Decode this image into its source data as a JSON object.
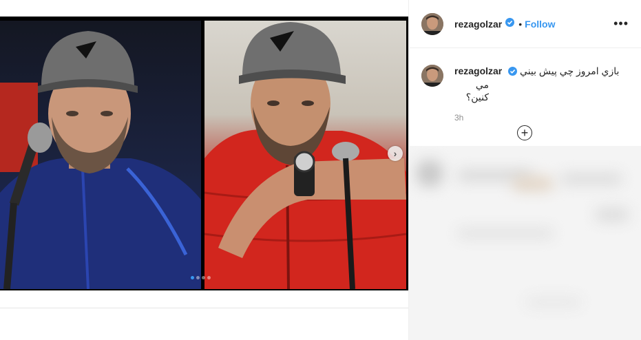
{
  "post": {
    "username": "rezagolzar",
    "follow_label": "Follow",
    "separator": "•",
    "more_label": "•••",
    "caption_line1": "بازي امروز چي پيش بيني",
    "caption_line2": "مي كنين؟",
    "time": "3h",
    "add_comment_icon": "+",
    "next_icon": "›",
    "carousel": {
      "total": 4,
      "active_index": 0
    }
  },
  "colors": {
    "accent": "#3897f0",
    "text": "#262626",
    "muted": "#8e8e8e"
  },
  "icons": [
    "verified-badge-icon",
    "more-options-icon",
    "carousel-next-icon",
    "add-comment-icon"
  ]
}
